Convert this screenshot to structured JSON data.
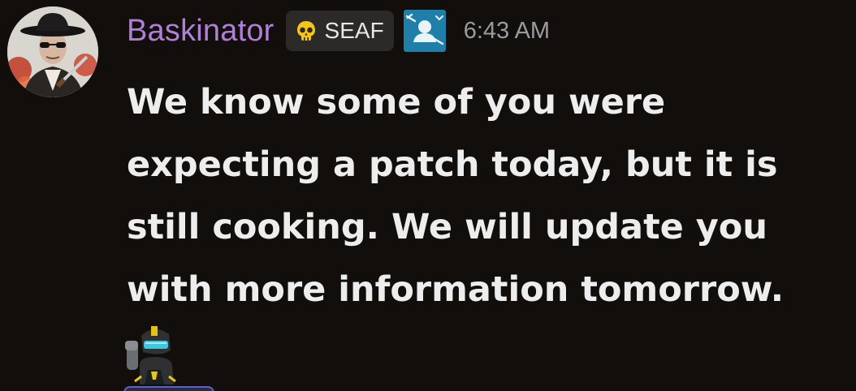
{
  "message": {
    "author": "Baskinator",
    "tag": {
      "label": "SEAF",
      "icon": "skull-icon"
    },
    "role_icon": "role-user-icon",
    "timestamp": "6:43 AM",
    "content": "We know some of you were expecting a patch today, but it is still cooking. We will update you with more information tomorrow.",
    "sticker": "helldiver-salute-emoji",
    "avatar": "user-avatar"
  },
  "colors": {
    "background": "#110e0c",
    "author_name": "#b07fd6",
    "message_text": "#ededee",
    "timestamp": "#9a9a9f",
    "tag_background": "#2b2a29",
    "role_icon_background": "#1f7fa8"
  }
}
